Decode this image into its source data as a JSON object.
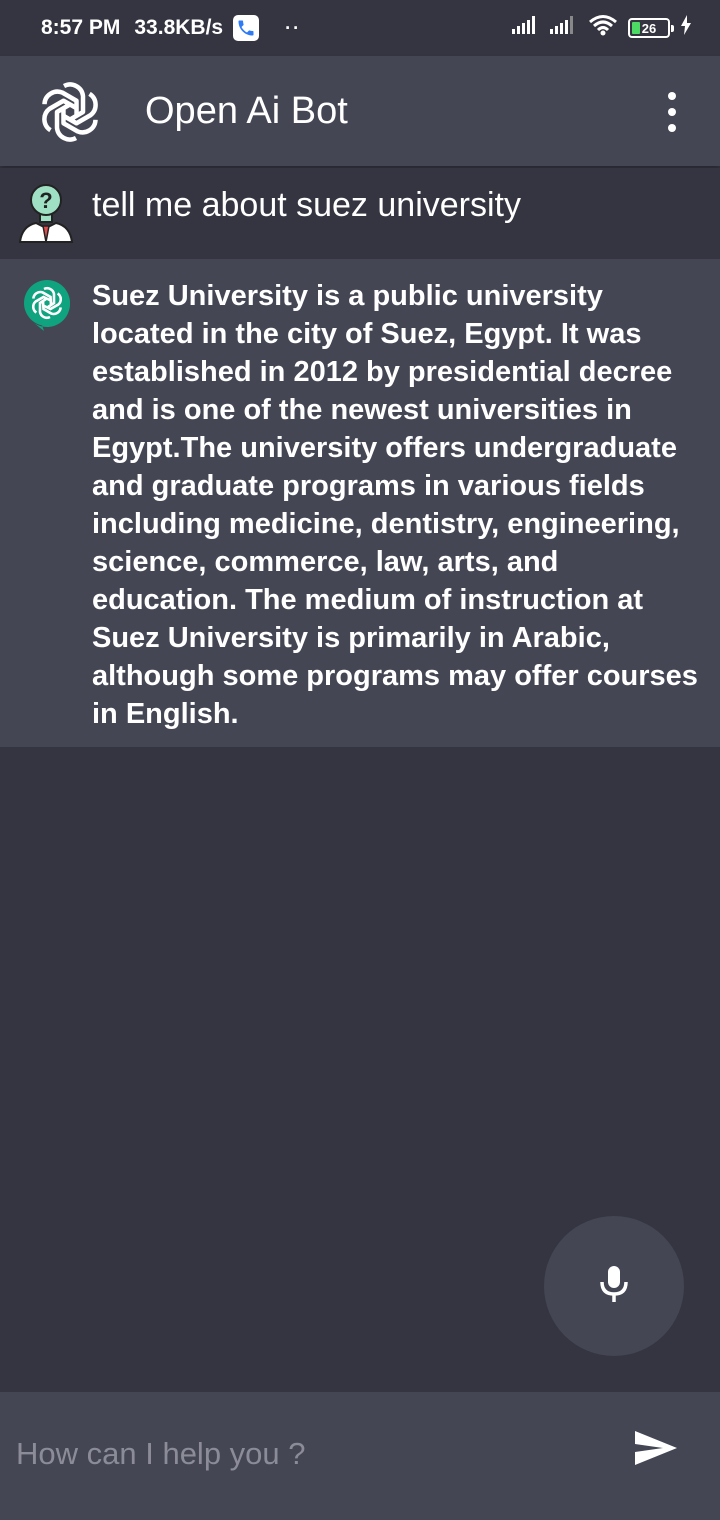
{
  "status_bar": {
    "time": "8:57 PM",
    "speed": "33.8KB/s",
    "dots": "··",
    "battery_level": "26",
    "icons": [
      "call-icon",
      "signal-icon",
      "signal-icon",
      "wifi-icon",
      "battery-icon",
      "charging-icon"
    ]
  },
  "app_bar": {
    "title": "Open Ai Bot",
    "logo_icon": "openai-logo-icon",
    "menu_icon": "more-vert-icon"
  },
  "messages": [
    {
      "role": "user",
      "avatar_icon": "question-person-avatar-icon",
      "text": "tell me about suez university"
    },
    {
      "role": "bot",
      "avatar_icon": "openai-chat-bubble-icon",
      "text": "Suez University is a public university located in the city of Suez, Egypt. It was established in 2012 by presidential decree and is one of the newest universities in Egypt.The university offers undergraduate and graduate programs in various fields including medicine, dentistry, engineering, science, commerce, law, arts, and education. The medium of instruction at Suez University is primarily in Arabic, although some programs may offer courses in English."
    }
  ],
  "mic_button": {
    "icon": "microphone-icon"
  },
  "input": {
    "placeholder": "How can I help you ?",
    "value": "",
    "send_icon": "send-icon"
  },
  "colors": {
    "background": "#353541",
    "surface": "#444654",
    "bot_accent": "#10a37f",
    "user_avatar_head": "#9fe0c5"
  }
}
